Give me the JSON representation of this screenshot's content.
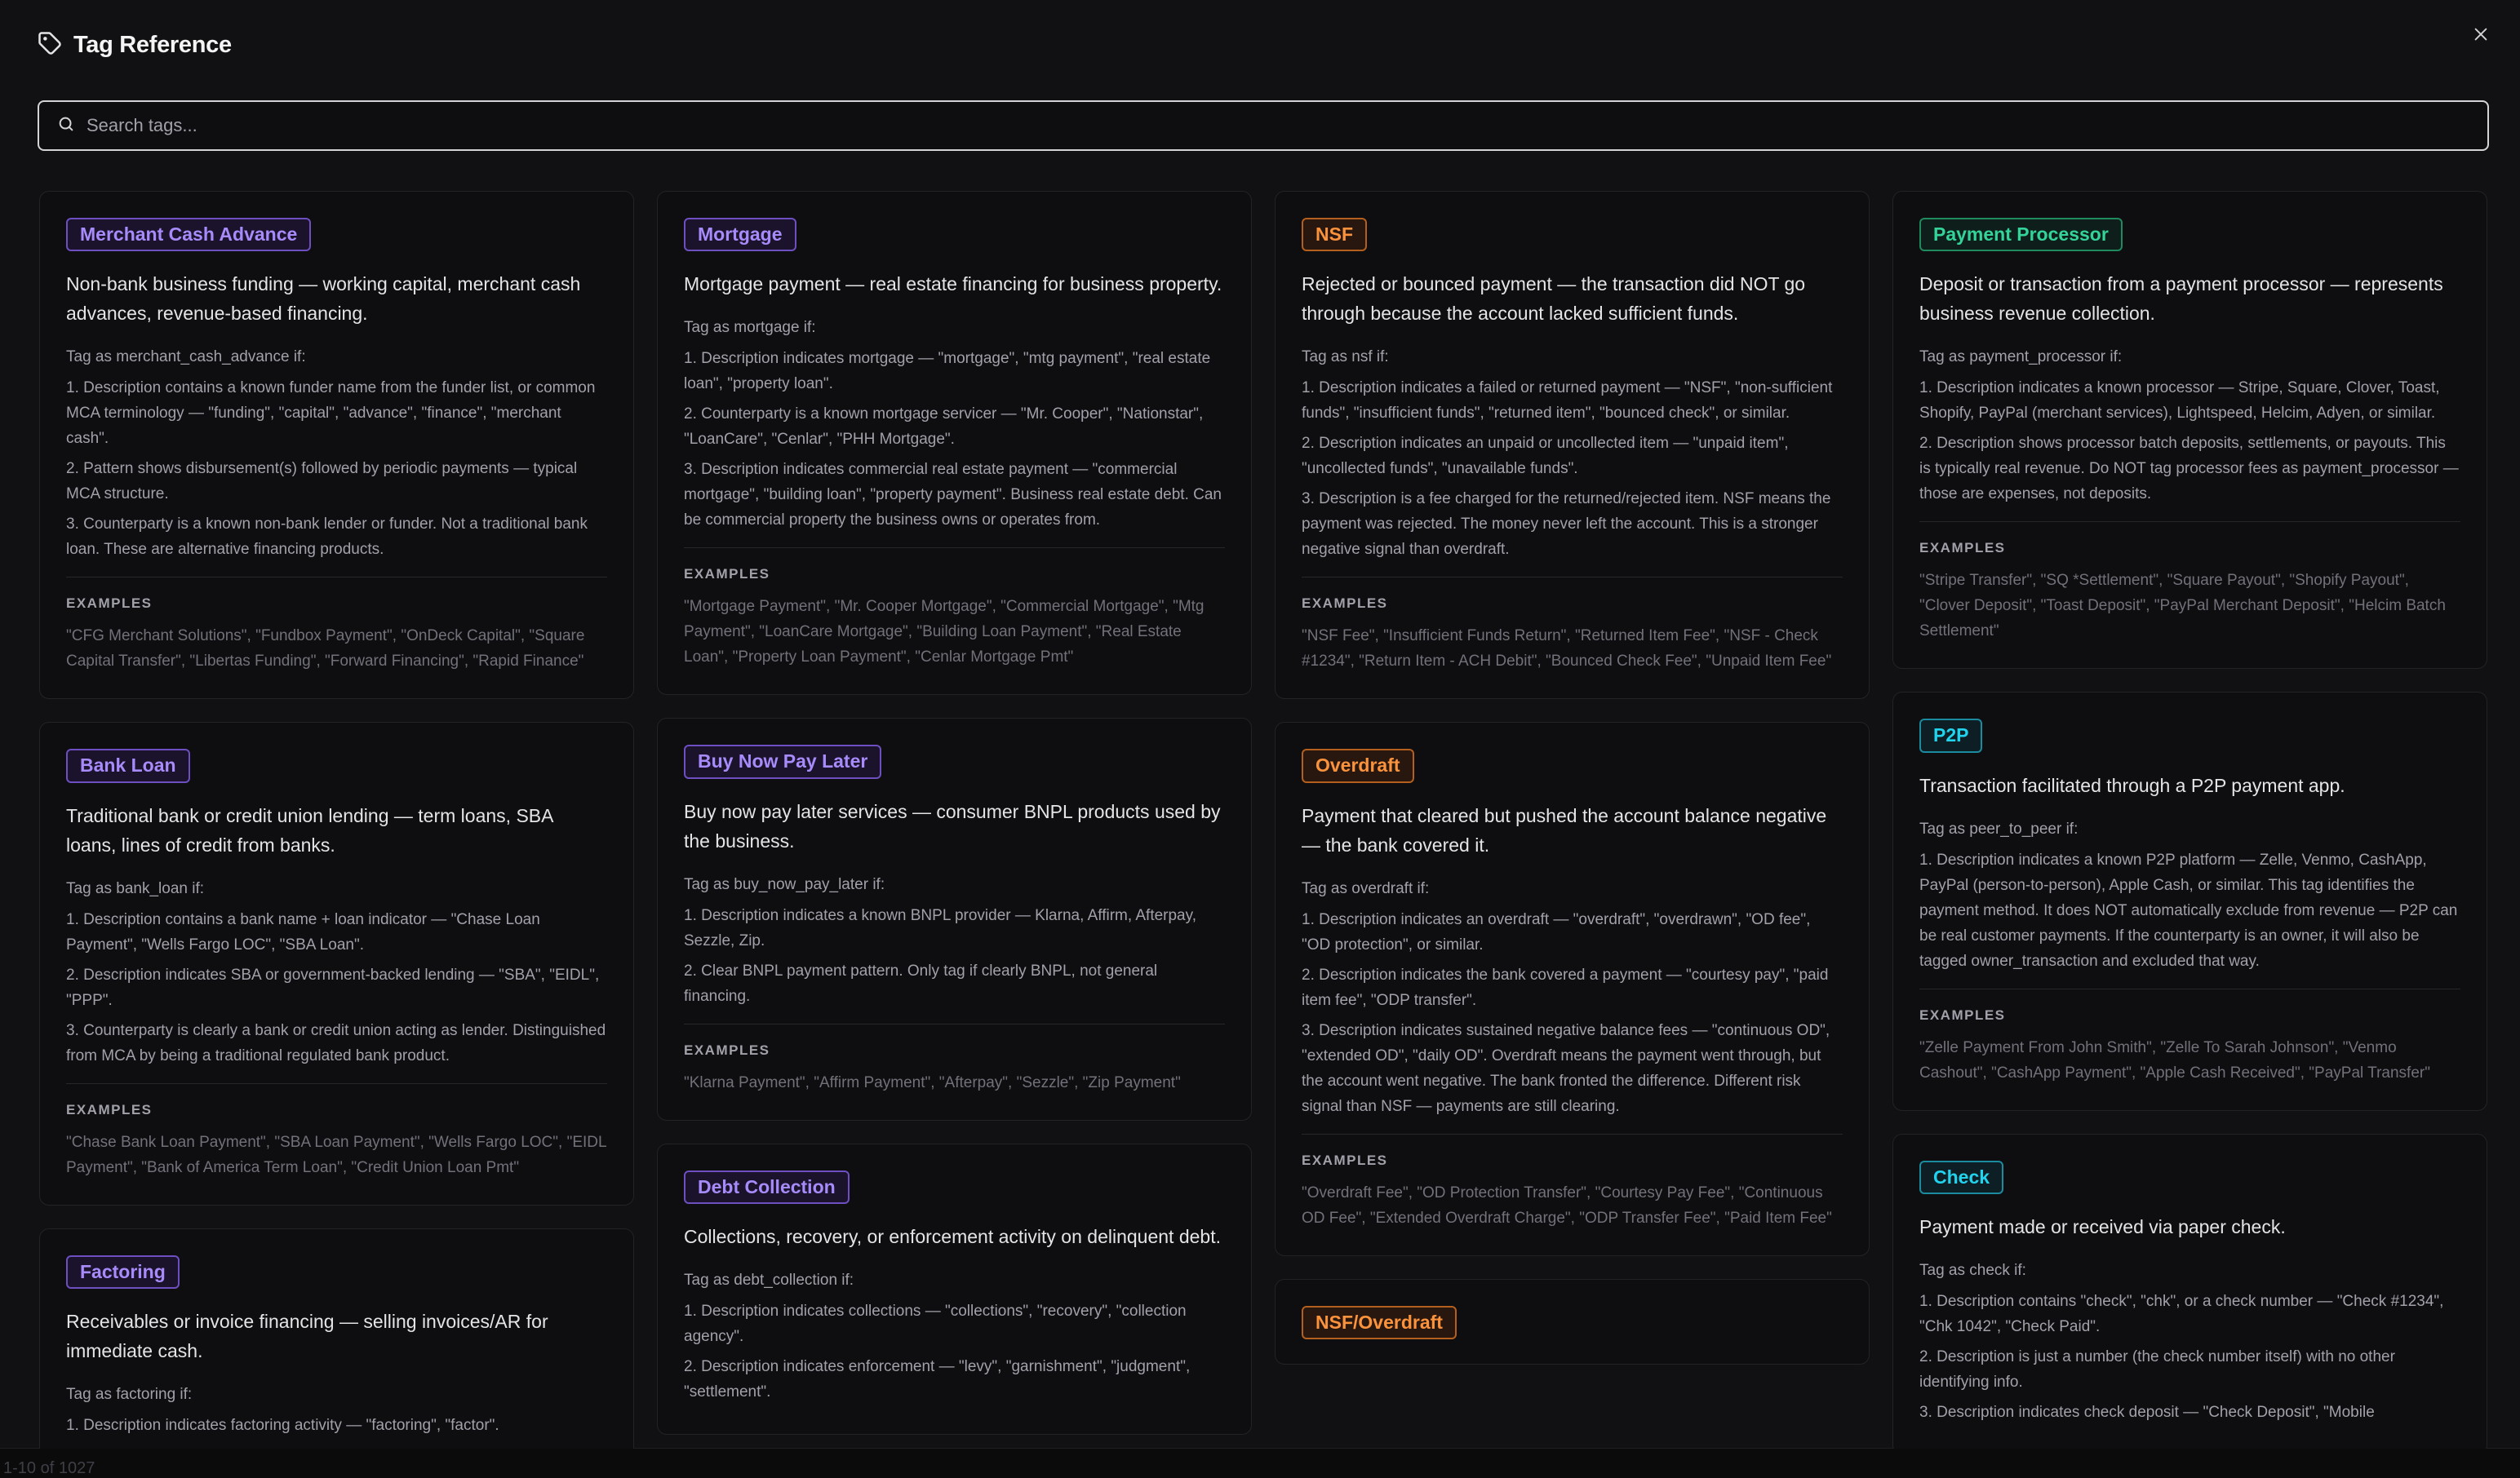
{
  "modal": {
    "title": "Tag Reference",
    "search_placeholder": "Search tags...",
    "tag_icon": "tag-icon",
    "close_icon": "close-icon",
    "search_icon": "search-icon"
  },
  "backdrop": {
    "pagination": "1-10 of 1027"
  },
  "columns": [
    [
      {
        "id": "merchant-cash-advance",
        "color": "purple",
        "label": "Merchant Cash Advance",
        "summary": "Non-bank business funding — working capital, merchant cash advances, revenue-based financing.",
        "rule_head": "Tag as merchant_cash_advance if:",
        "rules": [
          "1. Description contains a known funder name from the funder list, or common MCA terminology — \"funding\", \"capital\", \"advance\", \"finance\", \"merchant cash\".",
          "2. Pattern shows disbursement(s) followed by periodic payments — typical MCA structure.",
          "3. Counterparty is a known non-bank lender or funder. Not a traditional bank loan. These are alternative financing products."
        ],
        "examples_head": "EXAMPLES",
        "examples": "\"CFG Merchant Solutions\", \"Fundbox Payment\", \"OnDeck Capital\", \"Square Capital Transfer\", \"Libertas Funding\", \"Forward Financing\", \"Rapid Finance\""
      },
      {
        "id": "bank-loan",
        "color": "purple",
        "label": "Bank Loan",
        "summary": "Traditional bank or credit union lending — term loans, SBA loans, lines of credit from banks.",
        "rule_head": "Tag as bank_loan if:",
        "rules": [
          "1. Description contains a bank name + loan indicator — \"Chase Loan Payment\", \"Wells Fargo LOC\", \"SBA Loan\".",
          "2. Description indicates SBA or government-backed lending — \"SBA\", \"EIDL\", \"PPP\".",
          "3. Counterparty is clearly a bank or credit union acting as lender. Distinguished from MCA by being a traditional regulated bank product."
        ],
        "examples_head": "EXAMPLES",
        "examples": "\"Chase Bank Loan Payment\", \"SBA Loan Payment\", \"Wells Fargo LOC\", \"EIDL Payment\", \"Bank of America Term Loan\", \"Credit Union Loan Pmt\""
      },
      {
        "id": "factoring",
        "color": "purple",
        "label": "Factoring",
        "summary": "Receivables or invoice financing — selling invoices/AR for immediate cash.",
        "rule_head": "Tag as factoring if:",
        "rules": [
          "1. Description indicates factoring activity — \"factoring\", \"factor\"."
        ],
        "examples_head": "",
        "examples": ""
      }
    ],
    [
      {
        "id": "mortgage",
        "color": "purple",
        "label": "Mortgage",
        "summary": "Mortgage payment — real estate financing for business property.",
        "rule_head": "Tag as mortgage if:",
        "rules": [
          "1. Description indicates mortgage — \"mortgage\", \"mtg payment\", \"real estate loan\", \"property loan\".",
          "2. Counterparty is a known mortgage servicer — \"Mr. Cooper\", \"Nationstar\", \"LoanCare\", \"Cenlar\", \"PHH Mortgage\".",
          "3. Description indicates commercial real estate payment — \"commercial mortgage\", \"building loan\", \"property payment\". Business real estate debt. Can be commercial property the business owns or operates from."
        ],
        "examples_head": "EXAMPLES",
        "examples": "\"Mortgage Payment\", \"Mr. Cooper Mortgage\", \"Commercial Mortgage\", \"Mtg Payment\", \"LoanCare Mortgage\", \"Building Loan Payment\", \"Real Estate Loan\", \"Property Loan Payment\", \"Cenlar Mortgage Pmt\""
      },
      {
        "id": "buy-now-pay-later",
        "color": "purple",
        "label": "Buy Now Pay Later",
        "summary": "Buy now pay later services — consumer BNPL products used by the business.",
        "rule_head": "Tag as buy_now_pay_later if:",
        "rules": [
          "1. Description indicates a known BNPL provider — Klarna, Affirm, Afterpay, Sezzle, Zip.",
          "2. Clear BNPL payment pattern. Only tag if clearly BNPL, not general financing."
        ],
        "examples_head": "EXAMPLES",
        "examples": "\"Klarna Payment\", \"Affirm Payment\", \"Afterpay\", \"Sezzle\", \"Zip Payment\""
      },
      {
        "id": "debt-collection",
        "color": "purple",
        "label": "Debt Collection",
        "summary": "Collections, recovery, or enforcement activity on delinquent debt.",
        "rule_head": "Tag as debt_collection if:",
        "rules": [
          "1. Description indicates collections — \"collections\", \"recovery\", \"collection agency\".",
          "2. Description indicates enforcement — \"levy\", \"garnishment\", \"judgment\", \"settlement\"."
        ],
        "examples_head": "",
        "examples": ""
      }
    ],
    [
      {
        "id": "nsf",
        "color": "orange",
        "label": "NSF",
        "summary": "Rejected or bounced payment — the transaction did NOT go through because the account lacked sufficient funds.",
        "rule_head": "Tag as nsf if:",
        "rules": [
          "1. Description indicates a failed or returned payment — \"NSF\", \"non-sufficient funds\", \"insufficient funds\", \"returned item\", \"bounced check\", or similar.",
          "2. Description indicates an unpaid or uncollected item — \"unpaid item\", \"uncollected funds\", \"unavailable funds\".",
          "3. Description is a fee charged for the returned/rejected item. NSF means the payment was rejected. The money never left the account. This is a stronger negative signal than overdraft."
        ],
        "examples_head": "EXAMPLES",
        "examples": "\"NSF Fee\", \"Insufficient Funds Return\", \"Returned Item Fee\", \"NSF - Check #1234\", \"Return Item - ACH Debit\", \"Bounced Check Fee\", \"Unpaid Item Fee\""
      },
      {
        "id": "overdraft",
        "color": "orange",
        "label": "Overdraft",
        "summary": "Payment that cleared but pushed the account balance negative — the bank covered it.",
        "rule_head": "Tag as overdraft if:",
        "rules": [
          "1. Description indicates an overdraft — \"overdraft\", \"overdrawn\", \"OD fee\", \"OD protection\", or similar.",
          "2. Description indicates the bank covered a payment — \"courtesy pay\", \"paid item fee\", \"ODP transfer\".",
          "3. Description indicates sustained negative balance fees — \"continuous OD\", \"extended OD\", \"daily OD\". Overdraft means the payment went through, but the account went negative. The bank fronted the difference. Different risk signal than NSF — payments are still clearing."
        ],
        "examples_head": "EXAMPLES",
        "examples": "\"Overdraft Fee\", \"OD Protection Transfer\", \"Courtesy Pay Fee\", \"Continuous OD Fee\", \"Extended Overdraft Charge\", \"ODP Transfer Fee\", \"Paid Item Fee\""
      },
      {
        "id": "nsf-overdraft",
        "color": "orange",
        "label": "NSF/Overdraft",
        "summary": "",
        "rule_head": "",
        "rules": [],
        "examples_head": "",
        "examples": ""
      }
    ],
    [
      {
        "id": "payment-processor",
        "color": "green",
        "label": "Payment Processor",
        "summary": "Deposit or transaction from a payment processor — represents business revenue collection.",
        "rule_head": "Tag as payment_processor if:",
        "rules": [
          "1. Description indicates a known processor — Stripe, Square, Clover, Toast, Shopify, PayPal (merchant services), Lightspeed, Helcim, Adyen, or similar.",
          "2. Description shows processor batch deposits, settlements, or payouts. This is typically real revenue. Do NOT tag processor fees as payment_processor — those are expenses, not deposits."
        ],
        "examples_head": "EXAMPLES",
        "examples": "\"Stripe Transfer\", \"SQ *Settlement\", \"Square Payout\", \"Shopify Payout\", \"Clover Deposit\", \"Toast Deposit\", \"PayPal Merchant Deposit\", \"Helcim Batch Settlement\""
      },
      {
        "id": "p2p",
        "color": "cyan",
        "label": "P2P",
        "summary": "Transaction facilitated through a P2P payment app.",
        "rule_head": "Tag as peer_to_peer if:",
        "rules": [
          "1. Description indicates a known P2P platform — Zelle, Venmo, CashApp, PayPal (person-to-person), Apple Cash, or similar. This tag identifies the payment method. It does NOT automatically exclude from revenue — P2P can be real customer payments. If the counterparty is an owner, it will also be tagged owner_transaction and excluded that way."
        ],
        "examples_head": "EXAMPLES",
        "examples": "\"Zelle Payment From John Smith\", \"Zelle To Sarah Johnson\", \"Venmo Cashout\", \"CashApp Payment\", \"Apple Cash Received\", \"PayPal Transfer\""
      },
      {
        "id": "check",
        "color": "cyan",
        "label": "Check",
        "summary": "Payment made or received via paper check.",
        "rule_head": "Tag as check if:",
        "rules": [
          "1. Description contains \"check\", \"chk\", or a check number — \"Check #1234\", \"Chk 1042\", \"Check Paid\".",
          "2. Description is just a number (the check number itself) with no other identifying info.",
          "3. Description indicates check deposit — \"Check Deposit\", \"Mobile"
        ],
        "examples_head": "",
        "examples": ""
      }
    ]
  ]
}
